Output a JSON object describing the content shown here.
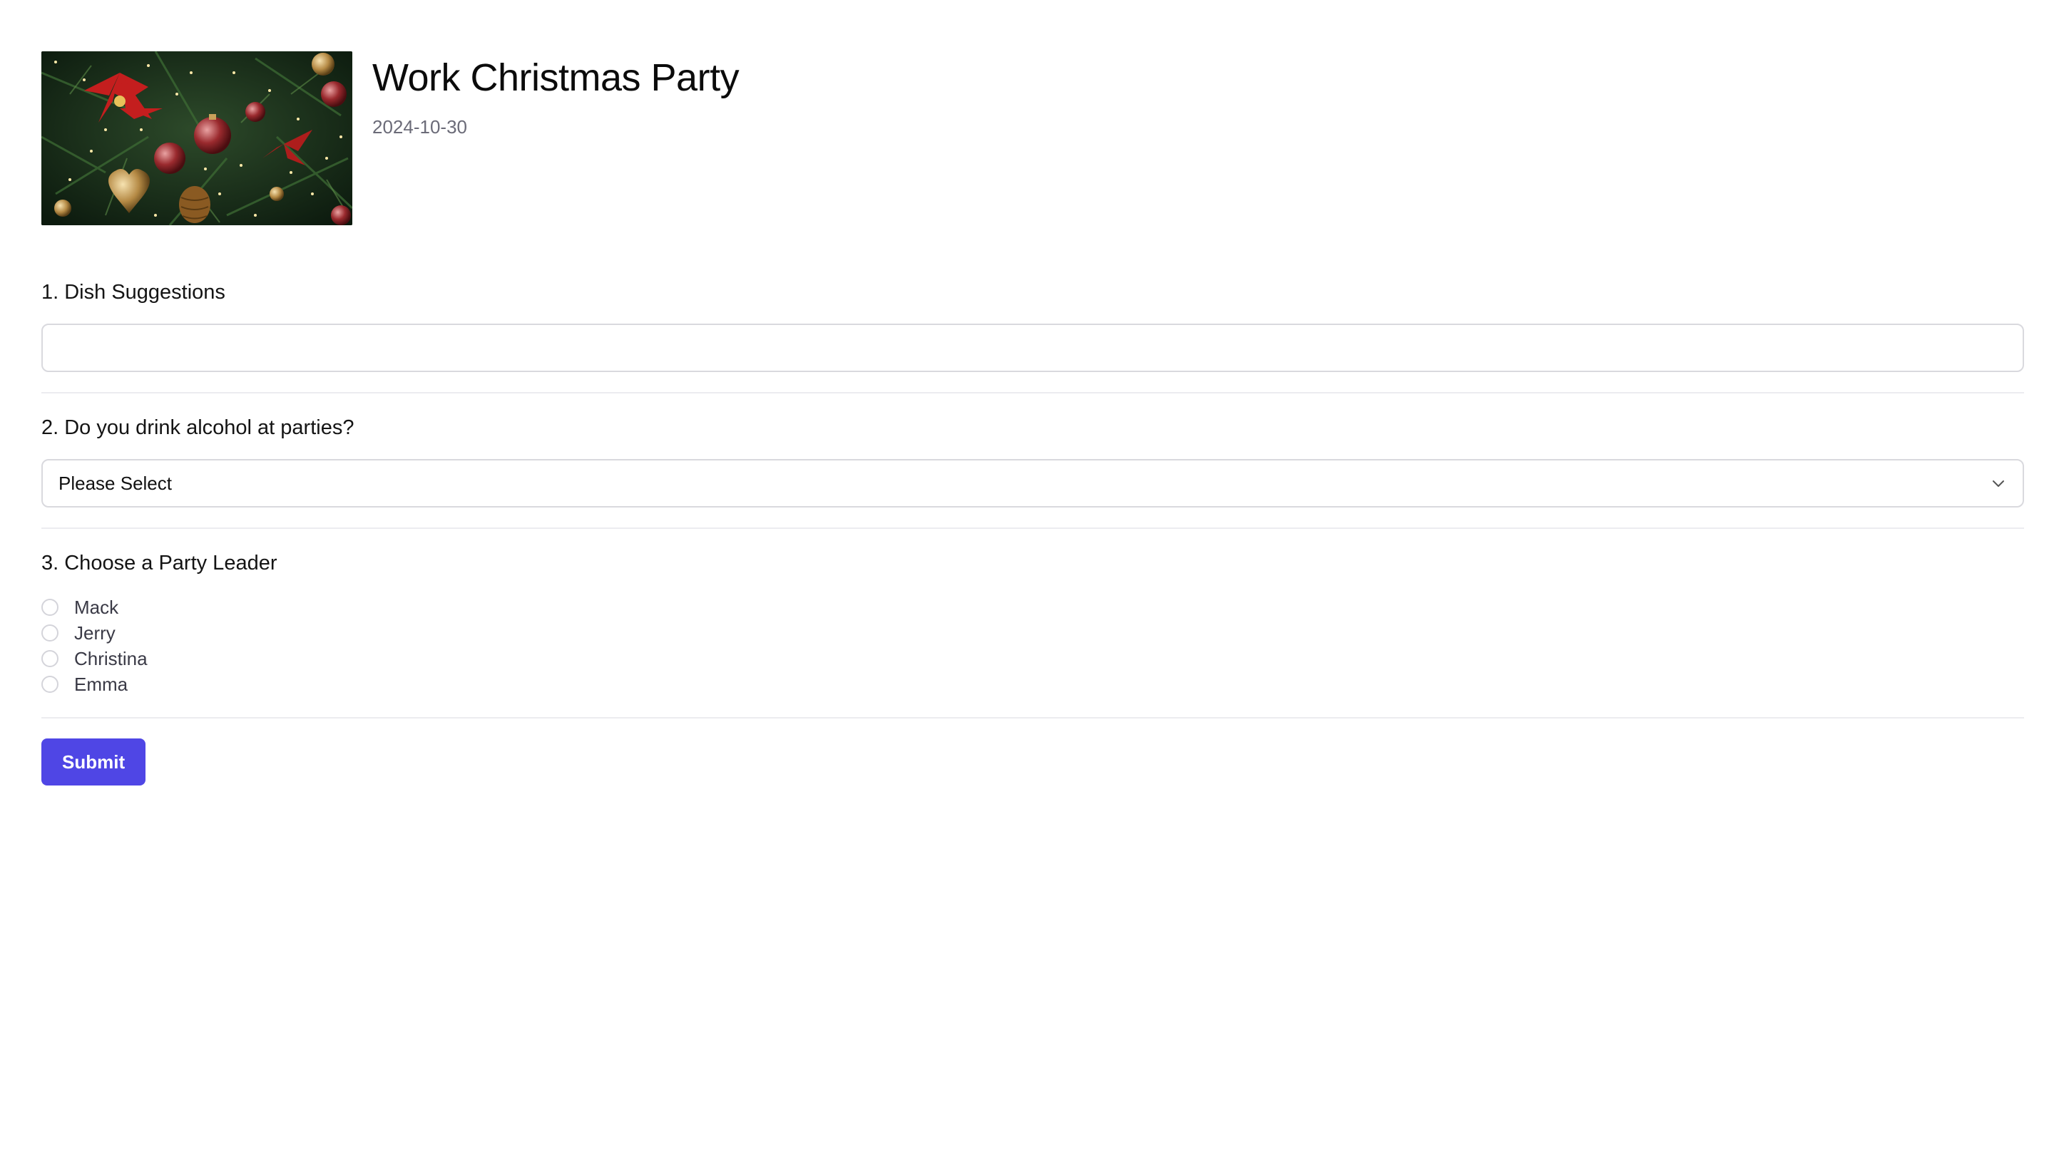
{
  "event": {
    "title": "Work Christmas Party",
    "date": "2024-10-30",
    "image_icon": "christmas-tree-ornaments-photo"
  },
  "questions": [
    {
      "label": "1. Dish Suggestions",
      "type": "text",
      "value": "",
      "placeholder": ""
    },
    {
      "label": "2. Do you drink alcohol at parties?",
      "type": "select",
      "selected": "Please Select"
    },
    {
      "label": "3. Choose a Party Leader",
      "type": "radio",
      "options": [
        "Mack",
        "Jerry",
        "Christina",
        "Emma"
      ]
    }
  ],
  "submit_label": "Submit",
  "colors": {
    "accent": "#4f46e5",
    "border": "#d9d9de",
    "divider": "#ececf0",
    "muted_text": "#6b6b78"
  }
}
